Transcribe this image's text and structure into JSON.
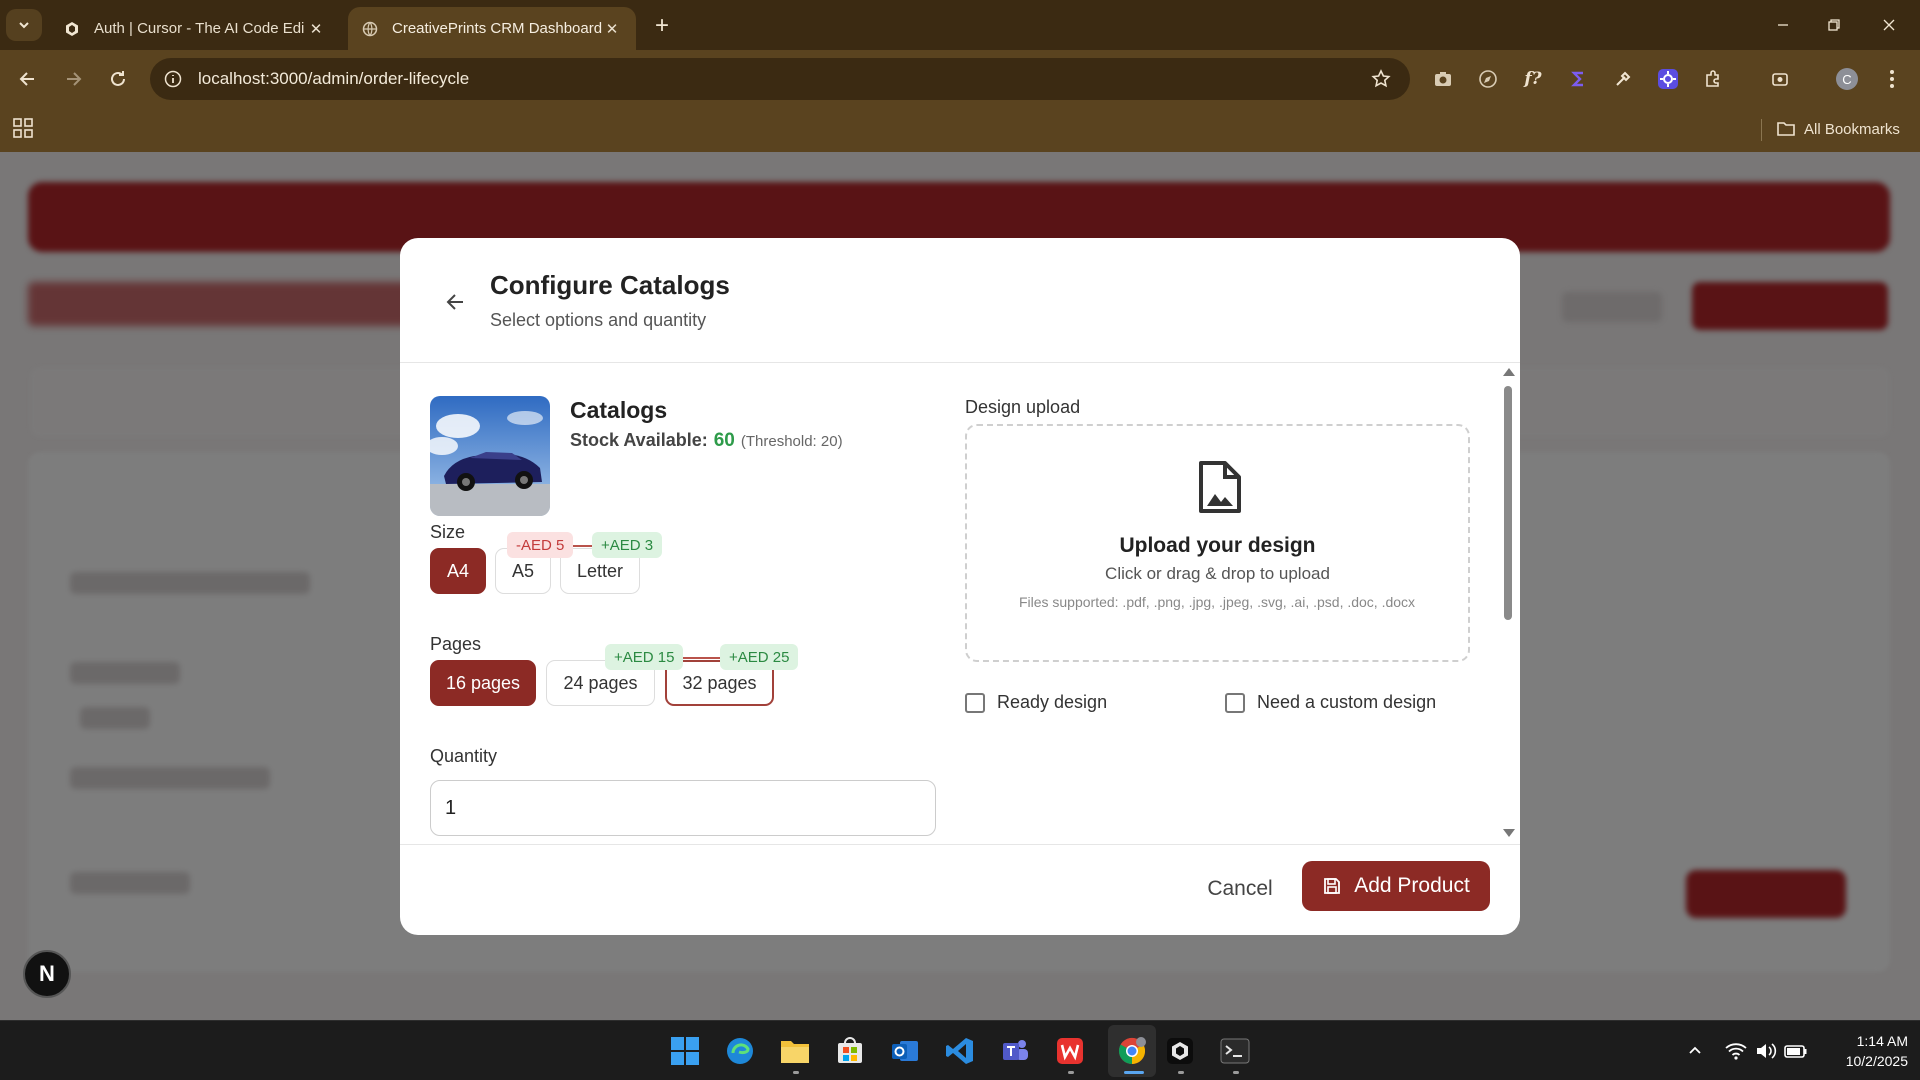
{
  "browser": {
    "tabs": [
      {
        "title": "Auth | Cursor - The AI Code Edi",
        "active": false,
        "icon": "cursor-icon"
      },
      {
        "title": "CreativePrints CRM Dashboard",
        "active": true,
        "icon": "globe-icon"
      }
    ],
    "url": "localhost:3000/admin/order-lifecycle",
    "bookmarks_label": "All Bookmarks",
    "profile_initial": "C"
  },
  "modal": {
    "title": "Configure Catalogs",
    "subtitle": "Select options and quantity",
    "product": {
      "name": "Catalogs",
      "stock_label": "Stock Available:",
      "stock_value": "60",
      "threshold": "(Threshold: 20)"
    },
    "size": {
      "label": "Size",
      "options": [
        {
          "label": "A4",
          "selected": true,
          "price": ""
        },
        {
          "label": "A5",
          "selected": false,
          "price": "-AED 5"
        },
        {
          "label": "Letter",
          "selected": false,
          "price": "+AED 3"
        }
      ]
    },
    "pages": {
      "label": "Pages",
      "options": [
        {
          "label": "16 pages",
          "selected": true,
          "price": ""
        },
        {
          "label": "24 pages",
          "selected": false,
          "price": "+AED 15"
        },
        {
          "label": "32 pages",
          "selected": false,
          "price": "+AED 25"
        }
      ]
    },
    "quantity": {
      "label": "Quantity",
      "value": "1"
    },
    "design": {
      "label": "Design upload",
      "title": "Upload your design",
      "subtitle": "Click or drag & drop to upload",
      "files": "Files supported: .pdf, .png, .jpg, .jpeg, .svg, .ai, .psd, .doc, .docx",
      "ready_label": "Ready design",
      "custom_label": "Need a custom design"
    },
    "footer": {
      "cancel": "Cancel",
      "add": "Add Product"
    }
  },
  "dev_badge": "N",
  "taskbar": {
    "time": "1:14 AM",
    "date": "10/2/2025"
  },
  "colors": {
    "accent": "#8c2a25",
    "positive": "#2e9b4a",
    "negative": "#c33b3b"
  }
}
